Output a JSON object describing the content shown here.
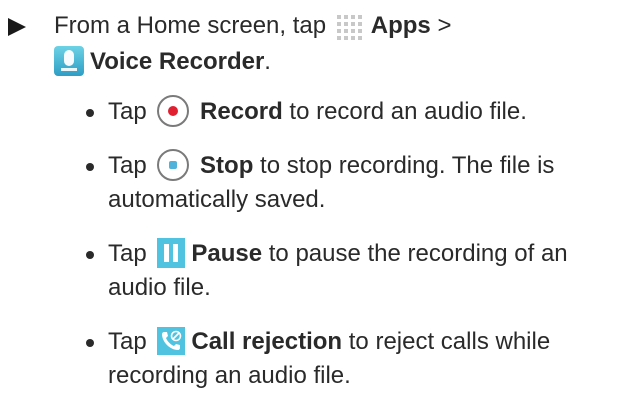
{
  "step": {
    "prefix": "From a Home screen, tap",
    "apps_label": "Apps",
    "separator": ">",
    "app_name": "Voice Recorder",
    "app_suffix": "."
  },
  "bullets": [
    {
      "tap": "Tap",
      "icon": "record-icon",
      "label": "Record",
      "line1": "to record an audio file.",
      "line2": ""
    },
    {
      "tap": "Tap",
      "icon": "stop-icon",
      "label": "Stop",
      "line1": "to stop recording. The file is",
      "line2": "automatically saved."
    },
    {
      "tap": "Tap",
      "icon": "pause-icon",
      "label": "Pause",
      "line1": "to pause the recording of an",
      "line2": "audio file."
    },
    {
      "tap": "Tap",
      "icon": "call-rejection-icon",
      "label": "Call rejection",
      "line1": "to reject calls while",
      "line2": "recording an audio file."
    }
  ],
  "colors": {
    "text": "#2a2a2a",
    "record_red": "#e02030",
    "accent_blue": "#4fc3df"
  }
}
